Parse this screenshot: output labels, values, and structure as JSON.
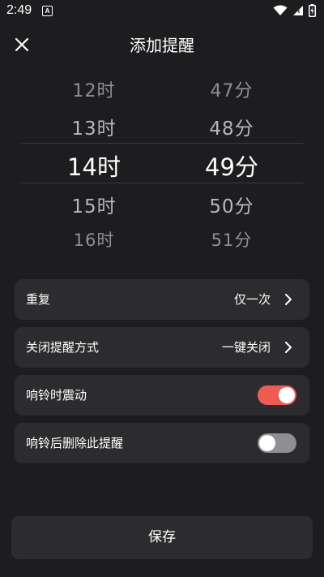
{
  "status_bar": {
    "time": "2:49",
    "notification_icon": "A"
  },
  "header": {
    "title": "添加提醒",
    "close_icon": "close-icon"
  },
  "time_picker": {
    "hours": [
      "12时",
      "13时",
      "14时",
      "15时",
      "16时"
    ],
    "minutes": [
      "47分",
      "48分",
      "49分",
      "50分",
      "51分"
    ],
    "selected_hour": "14时",
    "selected_minute": "49分"
  },
  "settings": {
    "repeat": {
      "label": "重复",
      "value": "仅一次"
    },
    "dismiss_method": {
      "label": "关闭提醒方式",
      "value": "一键关闭"
    },
    "vibrate": {
      "label": "响铃时震动",
      "enabled": true
    },
    "delete_after": {
      "label": "响铃后删除此提醒",
      "enabled": false
    }
  },
  "save_label": "保存",
  "colors": {
    "background": "#1d1d1f",
    "card": "#2c2c2e",
    "accent_toggle_on": "#ee5b55",
    "toggle_off": "#8e8e93"
  }
}
